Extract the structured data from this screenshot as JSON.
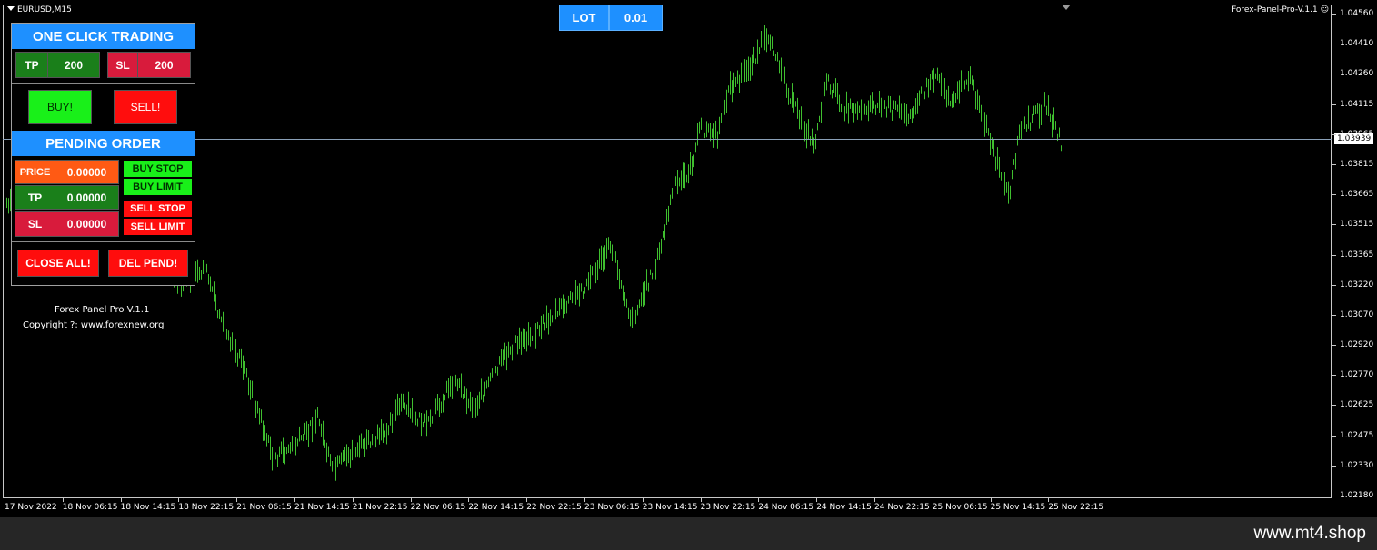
{
  "chart": {
    "symbol": "EURUSD,M15",
    "ea_name": "Forex-Panel-Pro-V.1.1 ☺",
    "bid_price": "1.03939",
    "bar_color": "#3fbf2f",
    "price_axis": [
      "1.04560",
      "1.04410",
      "1.04260",
      "1.04115",
      "1.03965",
      "1.03815",
      "1.03665",
      "1.03515",
      "1.03365",
      "1.03220",
      "1.03070",
      "1.02920",
      "1.02770",
      "1.02625",
      "1.02475",
      "1.02330",
      "1.02180"
    ],
    "time_axis": [
      "17 Nov 2022",
      "18 Nov 06:15",
      "18 Nov 14:15",
      "18 Nov 22:15",
      "21 Nov 06:15",
      "21 Nov 14:15",
      "21 Nov 22:15",
      "22 Nov 06:15",
      "22 Nov 14:15",
      "22 Nov 22:15",
      "23 Nov 06:15",
      "23 Nov 14:15",
      "23 Nov 22:15",
      "24 Nov 06:15",
      "24 Nov 14:15",
      "24 Nov 22:15",
      "25 Nov 06:15",
      "25 Nov 14:15",
      "25 Nov 22:15"
    ]
  },
  "lot": {
    "label": "LOT",
    "value": "0.01"
  },
  "panel": {
    "title": "ONE CLICK TRADING",
    "tp_label": "TP",
    "tp_value": "200",
    "sl_label": "SL",
    "sl_value": "200",
    "buy": "BUY!",
    "sell": "SELL!",
    "pending_title": "PENDING ORDER",
    "price_label": "PRICE",
    "price_value": "0.00000",
    "p_tp_label": "TP",
    "p_tp_value": "0.00000",
    "p_sl_label": "SL",
    "p_sl_value": "0.00000",
    "buy_stop": "BUY STOP",
    "buy_limit": "BUY LIMIT",
    "sell_stop": "SELL STOP",
    "sell_limit": "SELL LIMIT",
    "close_all": "CLOSE ALL!",
    "del_pend": "DEL PEND!"
  },
  "footer": {
    "line1": "Forex Panel Pro V.1.1",
    "line2": "Copyright ?: www.forexnew.org"
  },
  "watermark": "www.mt4.shop"
}
